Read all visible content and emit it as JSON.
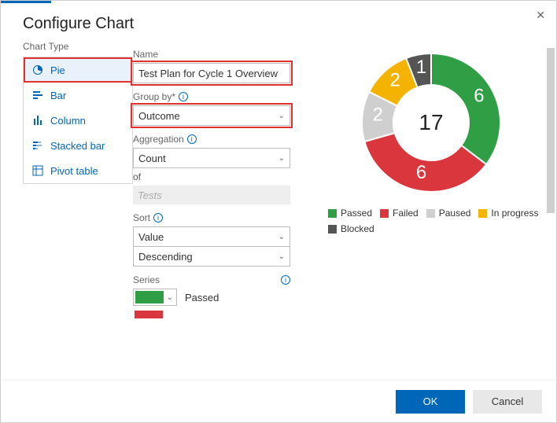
{
  "dialog": {
    "title": "Configure Chart"
  },
  "chart_type": {
    "label": "Chart Type",
    "items": [
      {
        "id": "pie",
        "label": "Pie"
      },
      {
        "id": "bar",
        "label": "Bar"
      },
      {
        "id": "column",
        "label": "Column"
      },
      {
        "id": "stackedbar",
        "label": "Stacked bar"
      },
      {
        "id": "pivot",
        "label": "Pivot table"
      }
    ],
    "selected": "pie"
  },
  "form": {
    "name_label": "Name",
    "name_value": "Test Plan for Cycle 1 Overview",
    "groupby_label": "Group by*",
    "groupby_value": "Outcome",
    "aggregation_label": "Aggregation",
    "aggregation_value": "Count",
    "of_label": "of",
    "of_value": "Tests",
    "sort_label": "Sort",
    "sort_field": "Value",
    "sort_direction": "Descending",
    "series_label": "Series",
    "series": [
      {
        "color": "#2f9e44",
        "label": "Passed"
      },
      {
        "color": "#d9363e",
        "label": ""
      }
    ]
  },
  "legend": [
    {
      "color": "#2f9e44",
      "label": "Passed"
    },
    {
      "color": "#d9363e",
      "label": "Failed"
    },
    {
      "color": "#cfcfcf",
      "label": "Paused"
    },
    {
      "color": "#f5b301",
      "label": "In progress"
    },
    {
      "color": "#555555",
      "label": "Blocked"
    }
  ],
  "chart_data": {
    "type": "pie",
    "title": "Test Plan for Cycle 1 Overview",
    "total": 17,
    "series": [
      {
        "name": "Passed",
        "value": 6,
        "color": "#2f9e44"
      },
      {
        "name": "Failed",
        "value": 6,
        "color": "#d9363e"
      },
      {
        "name": "Paused",
        "value": 2,
        "color": "#cfcfcf"
      },
      {
        "name": "In progress",
        "value": 2,
        "color": "#f5b301"
      },
      {
        "name": "Blocked",
        "value": 1,
        "color": "#555555"
      }
    ]
  },
  "buttons": {
    "ok": "OK",
    "cancel": "Cancel"
  }
}
